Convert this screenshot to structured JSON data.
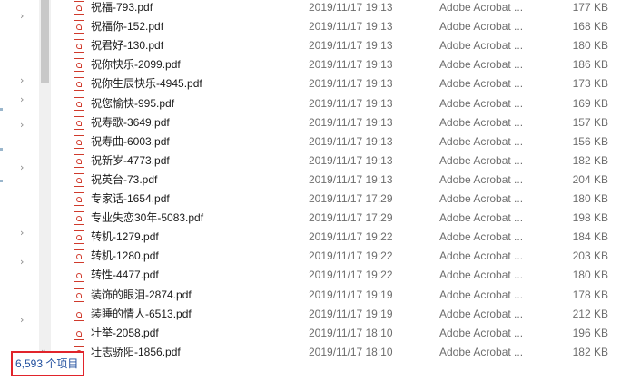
{
  "files": [
    {
      "name": "祝福-793.pdf",
      "modified": "2019/11/17 19:13",
      "type": "Adobe Acrobat ...",
      "size": "177 KB"
    },
    {
      "name": "祝福你-152.pdf",
      "modified": "2019/11/17 19:13",
      "type": "Adobe Acrobat ...",
      "size": "168 KB"
    },
    {
      "name": "祝君好-130.pdf",
      "modified": "2019/11/17 19:13",
      "type": "Adobe Acrobat ...",
      "size": "180 KB"
    },
    {
      "name": "祝你快乐-2099.pdf",
      "modified": "2019/11/17 19:13",
      "type": "Adobe Acrobat ...",
      "size": "186 KB"
    },
    {
      "name": "祝你生辰快乐-4945.pdf",
      "modified": "2019/11/17 19:13",
      "type": "Adobe Acrobat ...",
      "size": "173 KB"
    },
    {
      "name": "祝您愉快-995.pdf",
      "modified": "2019/11/17 19:13",
      "type": "Adobe Acrobat ...",
      "size": "169 KB"
    },
    {
      "name": "祝寿歌-3649.pdf",
      "modified": "2019/11/17 19:13",
      "type": "Adobe Acrobat ...",
      "size": "157 KB"
    },
    {
      "name": "祝寿曲-6003.pdf",
      "modified": "2019/11/17 19:13",
      "type": "Adobe Acrobat ...",
      "size": "156 KB"
    },
    {
      "name": "祝新岁-4773.pdf",
      "modified": "2019/11/17 19:13",
      "type": "Adobe Acrobat ...",
      "size": "182 KB"
    },
    {
      "name": "祝英台-73.pdf",
      "modified": "2019/11/17 19:13",
      "type": "Adobe Acrobat ...",
      "size": "204 KB"
    },
    {
      "name": "专家话-1654.pdf",
      "modified": "2019/11/17 17:29",
      "type": "Adobe Acrobat ...",
      "size": "180 KB"
    },
    {
      "name": "专业失恋30年-5083.pdf",
      "modified": "2019/11/17 17:29",
      "type": "Adobe Acrobat ...",
      "size": "198 KB"
    },
    {
      "name": "转机-1279.pdf",
      "modified": "2019/11/17 19:22",
      "type": "Adobe Acrobat ...",
      "size": "184 KB"
    },
    {
      "name": "转机-1280.pdf",
      "modified": "2019/11/17 19:22",
      "type": "Adobe Acrobat ...",
      "size": "203 KB"
    },
    {
      "name": "转性-4477.pdf",
      "modified": "2019/11/17 19:22",
      "type": "Adobe Acrobat ...",
      "size": "180 KB"
    },
    {
      "name": "装饰的眼泪-2874.pdf",
      "modified": "2019/11/17 19:19",
      "type": "Adobe Acrobat ...",
      "size": "178 KB"
    },
    {
      "name": "装睡的情人-6513.pdf",
      "modified": "2019/11/17 19:19",
      "type": "Adobe Acrobat ...",
      "size": "212 KB"
    },
    {
      "name": "壮举-2058.pdf",
      "modified": "2019/11/17 18:10",
      "type": "Adobe Acrobat ...",
      "size": "196 KB"
    },
    {
      "name": "壮志骄阳-1856.pdf",
      "modified": "2019/11/17 18:10",
      "type": "Adobe Acrobat ...",
      "size": "182 KB"
    }
  ],
  "status": {
    "item_count": "6,593 个项目"
  },
  "icons": {
    "file": "pdf-file-icon",
    "expand": "chevron-right-icon",
    "collapse": "chevron-down-icon"
  },
  "colors": {
    "status_text": "#1f4e9e",
    "highlight_border": "#e1242b",
    "secondary_text": "#6d6d6d",
    "pdf_red": "#d03a2c"
  }
}
